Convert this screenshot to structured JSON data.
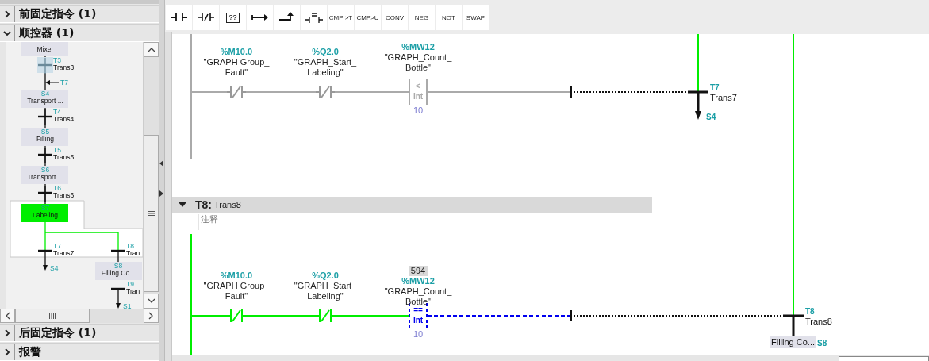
{
  "left_panel": {
    "sections_top": [
      {
        "label": "前固定指令 (1)",
        "expanded": false
      },
      {
        "label": "顺控器 (1)",
        "expanded": true
      }
    ],
    "overview": {
      "chain": [
        {
          "kind": "step",
          "name": "Mixer",
          "active": false
        },
        {
          "kind": "transition",
          "number": "T3",
          "name": "Trans3",
          "selected": true
        },
        {
          "kind": "jump_in",
          "number": "T7"
        },
        {
          "kind": "step",
          "number": "S4",
          "name": "Transport ...",
          "active": false
        },
        {
          "kind": "transition",
          "number": "T4",
          "name": "Trans4",
          "selected": false
        },
        {
          "kind": "step",
          "number": "S5",
          "name": "Filling",
          "active": false
        },
        {
          "kind": "transition",
          "number": "T5",
          "name": "Trans5",
          "selected": false
        },
        {
          "kind": "step",
          "number": "S6",
          "name": "Transport ...",
          "active": false
        },
        {
          "kind": "transition",
          "number": "T6",
          "name": "Trans6",
          "selected": false
        },
        {
          "kind": "step",
          "number": "S7",
          "name": "Labeling",
          "active": true
        }
      ],
      "branches": [
        [
          {
            "kind": "transition",
            "number": "T7",
            "name": "Trans7",
            "selected": false
          },
          {
            "kind": "jump",
            "target": "S4"
          }
        ],
        [
          {
            "kind": "transition",
            "number": "T8",
            "name": "Tran",
            "selected": false
          },
          {
            "kind": "step",
            "number": "S8",
            "name": "Filling Co...",
            "active": false
          },
          {
            "kind": "transition",
            "number": "T9",
            "name": "Tran",
            "selected": false
          },
          {
            "kind": "jump",
            "target": "S1"
          }
        ]
      ]
    },
    "sections_bottom": [
      {
        "label": "后固定指令 (1)",
        "expanded": false
      },
      {
        "label": "报警",
        "expanded": false
      }
    ]
  },
  "toolbar": [
    {
      "kind": "no_contact"
    },
    {
      "kind": "nc_contact"
    },
    {
      "kind": "box",
      "label": "??"
    },
    {
      "kind": "branch_open"
    },
    {
      "kind": "branch_close"
    },
    {
      "kind": "compare_contact"
    },
    {
      "kind": "text",
      "label": "CMP >T"
    },
    {
      "kind": "text",
      "label": "CMP>U"
    },
    {
      "kind": "text",
      "label": "CONV"
    },
    {
      "kind": "text",
      "label": "NEG"
    },
    {
      "kind": "text",
      "label": "NOT"
    },
    {
      "kind": "text",
      "label": "SWAP"
    }
  ],
  "networks": [
    {
      "elements": [
        {
          "kind": "nc_contact",
          "address": "%M10.0",
          "tag": [
            "\"GRAPH Group_",
            "Fault\""
          ],
          "powered": false
        },
        {
          "kind": "nc_contact",
          "address": "%Q2.0",
          "tag": [
            "\"GRAPH_Start_",
            "Labeling\""
          ],
          "powered": false
        },
        {
          "kind": "compare",
          "address": "%MW12",
          "tag": [
            "\"GRAPH_Count_",
            "Bottle\""
          ],
          "operator": "<",
          "type": "Int",
          "operand": "10",
          "powered": false,
          "selected": false
        }
      ],
      "transition": {
        "number": "T7",
        "name": "Trans7",
        "active": true,
        "next": {
          "kind": "jump",
          "target": "S4"
        }
      }
    },
    {
      "header": {
        "number": "T8:",
        "name": "Trans8",
        "expanded": true,
        "comment": "注释"
      },
      "elements": [
        {
          "kind": "nc_contact",
          "address": "%M10.0",
          "tag": [
            "\"GRAPH Group_",
            "Fault\""
          ],
          "powered": true
        },
        {
          "kind": "nc_contact",
          "address": "%Q2.0",
          "tag": [
            "\"GRAPH_Start_",
            "Labeling\""
          ],
          "powered": true
        },
        {
          "kind": "compare",
          "value": "594",
          "address": "%MW12",
          "tag": [
            "\"GRAPH_Count_",
            "Bottle\""
          ],
          "operator": "==",
          "type": "Int",
          "operand": "10",
          "powered": false,
          "selected": true
        }
      ],
      "transition": {
        "number": "T8",
        "name": "Trans8",
        "active": true,
        "next": {
          "kind": "step",
          "number": "S8",
          "name": "Filling Co..."
        }
      }
    }
  ]
}
